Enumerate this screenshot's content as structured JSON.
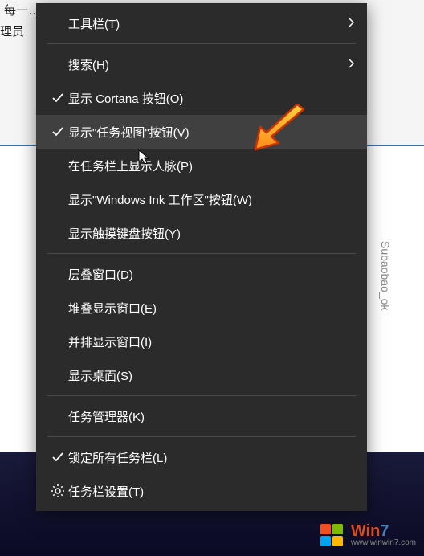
{
  "background": {
    "text1": "每一…………—……………………",
    "text2": "理员"
  },
  "watermark": "Subaobao_ok",
  "menu": {
    "group1": [
      {
        "label": "工具栏(T)",
        "checked": false,
        "submenu": true
      }
    ],
    "group2": [
      {
        "label": "搜索(H)",
        "checked": false,
        "submenu": true
      },
      {
        "label": "显示 Cortana 按钮(O)",
        "checked": true,
        "submenu": false
      },
      {
        "label": "显示\"任务视图\"按钮(V)",
        "checked": true,
        "submenu": false,
        "hovered": true
      },
      {
        "label": "在任务栏上显示人脉(P)",
        "checked": false,
        "submenu": false
      },
      {
        "label": "显示\"Windows Ink 工作区\"按钮(W)",
        "checked": false,
        "submenu": false
      },
      {
        "label": "显示触摸键盘按钮(Y)",
        "checked": false,
        "submenu": false
      }
    ],
    "group3": [
      {
        "label": "层叠窗口(D)",
        "checked": false,
        "submenu": false
      },
      {
        "label": "堆叠显示窗口(E)",
        "checked": false,
        "submenu": false
      },
      {
        "label": "并排显示窗口(I)",
        "checked": false,
        "submenu": false
      },
      {
        "label": "显示桌面(S)",
        "checked": false,
        "submenu": false
      }
    ],
    "group4": [
      {
        "label": "任务管理器(K)",
        "checked": false,
        "submenu": false
      }
    ],
    "group5": [
      {
        "label": "锁定所有任务栏(L)",
        "checked": true,
        "submenu": false
      },
      {
        "label": "任务栏设置(T)",
        "checked": false,
        "submenu": false,
        "gear": true
      }
    ]
  },
  "logo": {
    "brand1": "Win",
    "brand2": "7",
    "url": "www.winwin7.com"
  }
}
